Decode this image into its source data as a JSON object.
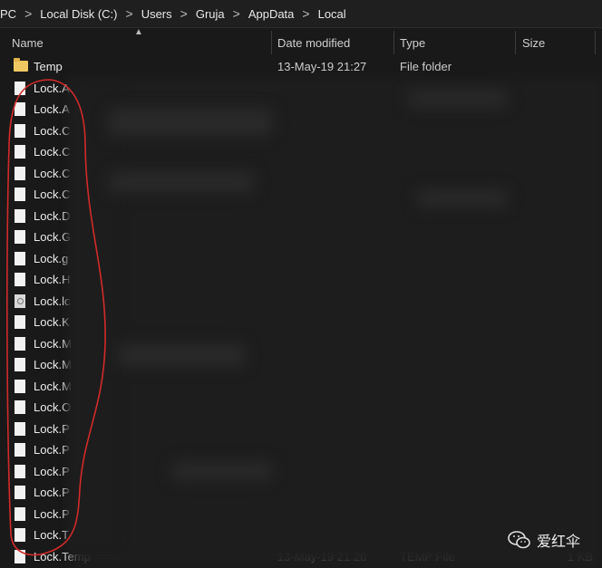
{
  "breadcrumb": [
    "PC",
    "Local Disk (C:)",
    "Users",
    "Gruja",
    "AppData",
    "Local"
  ],
  "breadcrumb_separator": ">",
  "columns": {
    "name": "Name",
    "date": "Date modified",
    "type": "Type",
    "size": "Size"
  },
  "files": [
    {
      "name": "Temp",
      "date": "13-May-19 21:27",
      "type": "File folder",
      "size": "",
      "icon": "folder-icon"
    },
    {
      "name": "Lock.A",
      "icon": "file-icon"
    },
    {
      "name": "Lock.A",
      "icon": "file-icon"
    },
    {
      "name": "Lock.C",
      "icon": "file-icon"
    },
    {
      "name": "Lock.C",
      "icon": "file-icon"
    },
    {
      "name": "Lock.C",
      "icon": "file-icon"
    },
    {
      "name": "Lock.C",
      "icon": "file-icon"
    },
    {
      "name": "Lock.D",
      "icon": "file-icon"
    },
    {
      "name": "Lock.G",
      "icon": "file-icon"
    },
    {
      "name": "Lock.g",
      "icon": "file-icon"
    },
    {
      "name": "Lock.H",
      "icon": "file-icon"
    },
    {
      "name": "Lock.lc",
      "icon": "settings-file-icon"
    },
    {
      "name": "Lock.K",
      "icon": "file-icon"
    },
    {
      "name": "Lock.M",
      "icon": "file-icon"
    },
    {
      "name": "Lock.M",
      "icon": "file-icon"
    },
    {
      "name": "Lock.M",
      "icon": "file-icon"
    },
    {
      "name": "Lock.O",
      "icon": "file-icon"
    },
    {
      "name": "Lock.P",
      "icon": "file-icon"
    },
    {
      "name": "Lock.P",
      "icon": "file-icon"
    },
    {
      "name": "Lock.P",
      "icon": "file-icon"
    },
    {
      "name": "Lock.P",
      "icon": "file-icon"
    },
    {
      "name": "Lock.P",
      "icon": "file-icon"
    },
    {
      "name": "Lock.T",
      "icon": "file-icon"
    },
    {
      "name": "Lock.Temp",
      "date": "13-May-19 21:26",
      "type": "TEMP File",
      "size": "1 KB",
      "icon": "file-icon"
    }
  ],
  "watermark": {
    "text": "爱红伞",
    "icon": "wechat-icon"
  },
  "colors": {
    "background": "#191919",
    "header": "#1f1f1f",
    "folder": "#f0c862",
    "annotation": "#d22a2a"
  }
}
